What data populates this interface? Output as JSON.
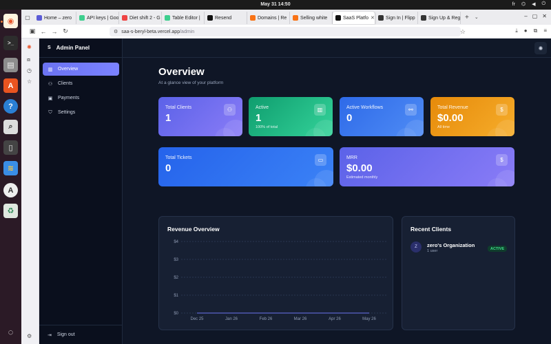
{
  "system": {
    "clock": "May 31  14:50",
    "keyboard_layout": "fr"
  },
  "browser": {
    "tabs": [
      {
        "label": "Home – zero",
        "color": "#5b5bd6",
        "active": false
      },
      {
        "label": "API keys | Goo",
        "color": "#3ecf8e",
        "active": false
      },
      {
        "label": "Diet shift 2 - G",
        "color": "#ef4444",
        "active": false
      },
      {
        "label": "Table Editor |",
        "color": "#3ecf8e",
        "active": false
      },
      {
        "label": "Resend",
        "color": "#111111",
        "active": false
      },
      {
        "label": "Domains | Re",
        "color": "#f97316",
        "active": false
      },
      {
        "label": "Selling white",
        "color": "#f97316",
        "active": false
      },
      {
        "label": "SaaS Platfo",
        "color": "#111111",
        "active": true
      },
      {
        "label": "Sign In | Flipp",
        "color": "#333333",
        "active": false
      },
      {
        "label": "Sign Up & Reg",
        "color": "#333333",
        "active": false
      }
    ],
    "url_host": "saa-s-beryl-beta.vercel.app",
    "url_path": "/admin"
  },
  "app": {
    "brand_logo": "S",
    "brand_name": "Admin Panel",
    "nav": [
      {
        "label": "Overview",
        "icon": "bar-chart-icon",
        "glyph": "▥",
        "active": true
      },
      {
        "label": "Clients",
        "icon": "users-icon",
        "glyph": "⚇",
        "active": false
      },
      {
        "label": "Payments",
        "icon": "credit-card-icon",
        "glyph": "▣",
        "active": false
      },
      {
        "label": "Settings",
        "icon": "shield-icon",
        "glyph": "⛉",
        "active": false
      }
    ],
    "sign_out": "Sign out"
  },
  "overview": {
    "title": "Overview",
    "subtitle": "At a glance view of your platform"
  },
  "stats": [
    {
      "label": "Total Clients",
      "value": "1",
      "sub": "",
      "icon": "users-icon",
      "glyph": "⚇",
      "gradient": [
        "#5b62e8",
        "#8a7cf7"
      ]
    },
    {
      "label": "Active",
      "value": "1",
      "sub": "100% of total",
      "icon": "bar-chart-icon",
      "glyph": "▥",
      "gradient": [
        "#0f9d6e",
        "#34d39a"
      ]
    },
    {
      "label": "Active Workflows",
      "value": "0",
      "sub": "",
      "icon": "workflow-icon",
      "glyph": "⚯",
      "gradient": [
        "#2e6ae8",
        "#4f8cf5"
      ]
    },
    {
      "label": "Total Revenue",
      "value": "$0.00",
      "sub": "All time",
      "icon": "dollar-icon",
      "glyph": "$",
      "gradient": [
        "#e68a0a",
        "#f6ad2b"
      ]
    },
    {
      "label": "Total Tickets",
      "value": "0",
      "sub": "",
      "icon": "ticket-icon",
      "glyph": "▭",
      "gradient": [
        "#2563eb",
        "#3b82f6"
      ]
    },
    {
      "label": "MRR",
      "value": "$0.00",
      "sub": "Estimated monthly",
      "icon": "dollar-icon",
      "glyph": "$",
      "gradient": [
        "#5b62e8",
        "#8a7cf7"
      ]
    }
  ],
  "revenue_panel": {
    "title": "Revenue Overview"
  },
  "chart_data": {
    "type": "line",
    "title": "Revenue Overview",
    "categories": [
      "Dec 25",
      "Jan 26",
      "Feb 26",
      "Mar 26",
      "Apr 26",
      "May 26"
    ],
    "values": [
      0,
      0,
      0,
      0,
      0,
      0
    ],
    "y_ticks": [
      "$0",
      "$1",
      "$2",
      "$3",
      "$4"
    ],
    "ylim": [
      0,
      4
    ],
    "grid": true,
    "line_color": "#6b73f2"
  },
  "recent_clients": {
    "title": "Recent Clients",
    "items": [
      {
        "initial": "Z",
        "name": "zero's Organization",
        "users": "1 user",
        "status": "ACTIVE"
      }
    ]
  }
}
